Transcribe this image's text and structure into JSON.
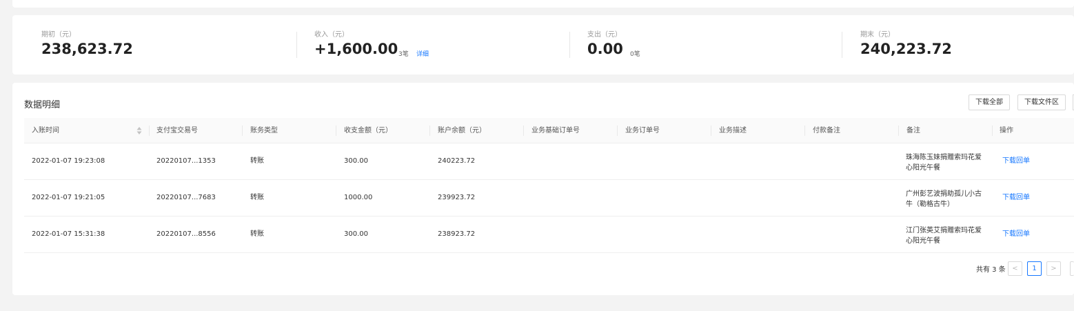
{
  "summary": [
    {
      "label": "期初（元）",
      "value": "238,623.72"
    },
    {
      "label": "收入（元）",
      "value": "+1,600.00",
      "count": "3笔",
      "link": "详细"
    },
    {
      "label": "支出（元）",
      "value": "0.00",
      "count": "0笔"
    },
    {
      "label": "期末（元）",
      "value": "240,223.72"
    }
  ],
  "detail": {
    "title": "数据明细",
    "buttons": {
      "download_all": "下载全部",
      "download_area": "下载文件区"
    },
    "columns": [
      "入账时间",
      "支付宝交易号",
      "账务类型",
      "收支金额（元）",
      "账户余额（元）",
      "业务基础订单号",
      "业务订单号",
      "业务描述",
      "付款备注",
      "备注",
      "操作"
    ],
    "rows": [
      {
        "time": "2022-01-07 19:23:08",
        "trade_no": "20220107...1353",
        "type": "转账",
        "amount": "300.00",
        "balance": "240223.72",
        "note": "珠海陈玉妹捐赠索玛花爱心阳光午餐",
        "action": "下载回单"
      },
      {
        "time": "2022-01-07 19:21:05",
        "trade_no": "20220107...7683",
        "type": "转账",
        "amount": "1000.00",
        "balance": "239923.72",
        "note": "广州彭艺波捐助孤儿小古牛（勒格古牛）",
        "action": "下载回单"
      },
      {
        "time": "2022-01-07 15:31:38",
        "trade_no": "20220107...8556",
        "type": "转账",
        "amount": "300.00",
        "balance": "238923.72",
        "note": "江门张英艾捐赠索玛花爱心阳光午餐",
        "action": "下载回单"
      }
    ]
  },
  "pagination": {
    "total": "共有 3 条",
    "prev": "<",
    "current": "1",
    "next": ">"
  }
}
